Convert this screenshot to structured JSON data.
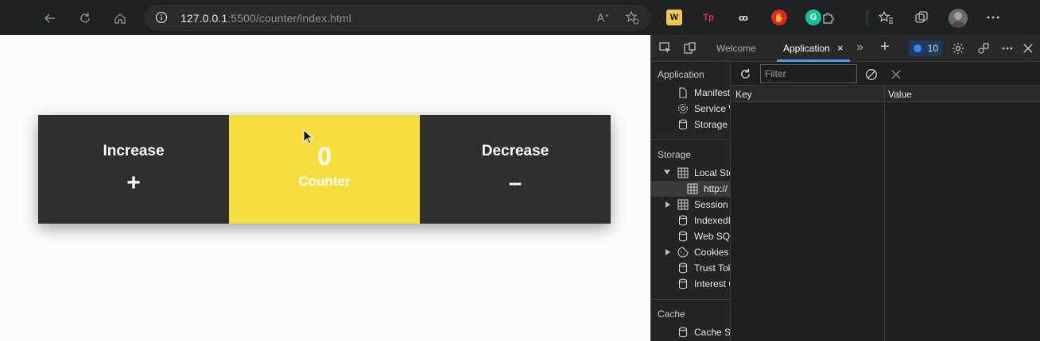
{
  "browser": {
    "address": {
      "host": "127.0.0.1",
      "rest": ":5500/counter/index.html"
    },
    "extensions": [
      {
        "name": "w-extension-icon",
        "glyph": "W",
        "bg": "#f2c94c",
        "fg": "#111111"
      },
      {
        "name": "tp-extension-icon",
        "glyph": "Tp",
        "bg": "transparent",
        "fg": "#e23b3b"
      },
      {
        "name": "infinity-extension-icon",
        "glyph": "ꝏ",
        "bg": "transparent",
        "fg": "#d8d8d8"
      },
      {
        "name": "hand-extension-icon",
        "glyph": "✋",
        "bg": "#e02424",
        "fg": "#ffffff"
      },
      {
        "name": "grammarly-extension-icon",
        "glyph": "G",
        "bg": "#15c39a",
        "fg": "#ffffff"
      }
    ]
  },
  "counter": {
    "increase_label": "Increase",
    "increase_symbol": "+",
    "value": "0",
    "name": "Counter",
    "decrease_label": "Decrease",
    "decrease_symbol": "–"
  },
  "devtools": {
    "tabs": {
      "welcome": "Welcome",
      "application": "Application",
      "more": "»",
      "add": "+"
    },
    "issues_count": "10",
    "sidebar": {
      "application_title": "Application",
      "application_items": [
        "Manifest",
        "Service W",
        "Storage"
      ],
      "storage_title": "Storage",
      "storage_items": [
        "Local Sto",
        "http://",
        "Session",
        "IndexedD",
        "Web SQL",
        "Cookies",
        "Trust Tok",
        "Interest G"
      ],
      "cache_title": "Cache",
      "cache_items": [
        "Cache S"
      ]
    },
    "filter_placeholder": "Filter",
    "columns": {
      "key": "Key",
      "value": "Value"
    }
  },
  "colors": {
    "accent_yellow": "#f7dd3d",
    "panel_dark": "#2f2f2f",
    "devtools_blue": "#4c9fff"
  }
}
